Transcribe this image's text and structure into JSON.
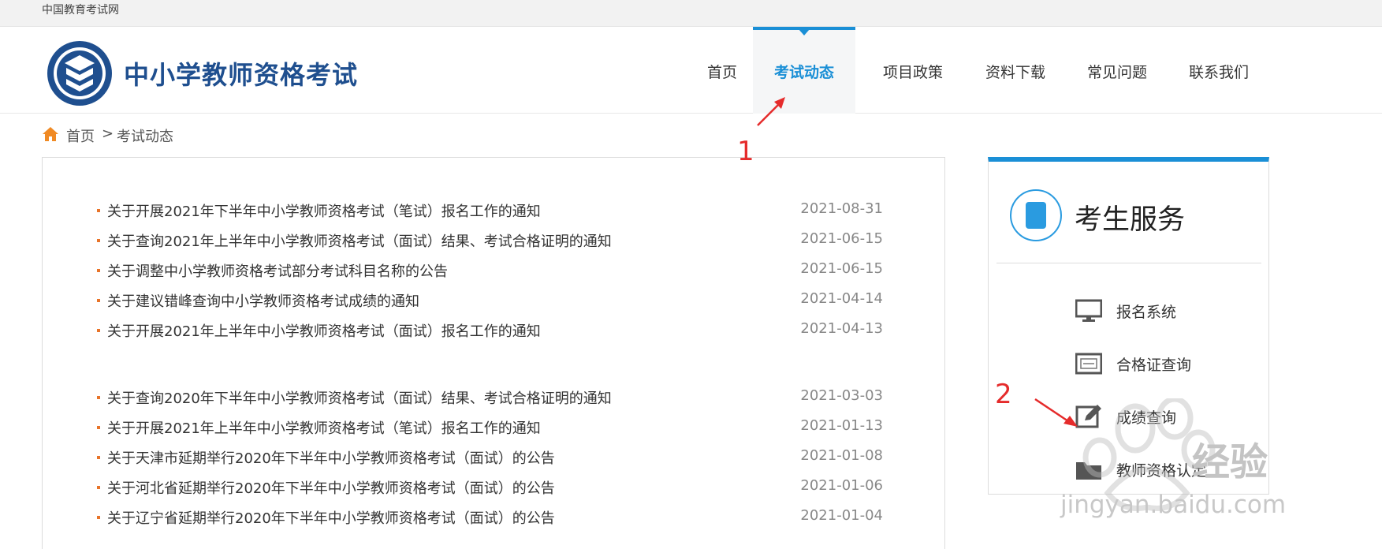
{
  "topbar": {
    "link": "中国教育考试网"
  },
  "header": {
    "site_title": "中小学教师资格考试",
    "nav": [
      {
        "label": "首页"
      },
      {
        "label": "考试动态"
      },
      {
        "label": "项目政策"
      },
      {
        "label": "资料下载"
      },
      {
        "label": "常见问题"
      },
      {
        "label": "联系我们"
      }
    ],
    "active_nav": "考试动态"
  },
  "breadcrumb": {
    "home": "首页",
    "separator": ">",
    "current": "考试动态"
  },
  "news": [
    {
      "title": "关于开展2021年下半年中小学教师资格考试（笔试）报名工作的通知",
      "date": "2021-08-31"
    },
    {
      "title": "关于查询2021年上半年中小学教师资格考试（面试）结果、考试合格证明的通知",
      "date": "2021-06-15"
    },
    {
      "title": "关于调整中小学教师资格考试部分考试科目名称的公告",
      "date": "2021-06-15"
    },
    {
      "title": "关于建议错峰查询中小学教师资格考试成绩的通知",
      "date": "2021-04-14"
    },
    {
      "title": "关于开展2021年上半年中小学教师资格考试（面试）报名工作的通知",
      "date": "2021-04-13"
    },
    {
      "title": "关于查询2020年下半年中小学教师资格考试（面试）结果、考试合格证明的通知",
      "date": "2021-03-03"
    },
    {
      "title": "关于开展2021年上半年中小学教师资格考试（笔试）报名工作的通知",
      "date": "2021-01-13"
    },
    {
      "title": "关于天津市延期举行2020年下半年中小学教师资格考试（面试）的公告",
      "date": "2021-01-08"
    },
    {
      "title": "关于河北省延期举行2020年下半年中小学教师资格考试（面试）的公告",
      "date": "2021-01-06"
    },
    {
      "title": "关于辽宁省延期举行2020年下半年中小学教师资格考试（面试）的公告",
      "date": "2021-01-04"
    }
  ],
  "services": {
    "title": "考生服务",
    "items": [
      {
        "label": "报名系统",
        "icon": "monitor-icon"
      },
      {
        "label": "合格证查询",
        "icon": "certificate-icon"
      },
      {
        "label": "成绩查询",
        "icon": "edit-icon"
      },
      {
        "label": "教师资格认定",
        "icon": "folder-icon"
      }
    ]
  },
  "annotations": {
    "one": "1",
    "two": "2"
  },
  "watermark": {
    "brand": "经验",
    "url": "jingyan.baidu.com"
  },
  "colors": {
    "accent": "#1a8fd6",
    "title_blue": "#1f4f8f",
    "bullet": "#e8742a",
    "annotation": "#e52b2b"
  }
}
